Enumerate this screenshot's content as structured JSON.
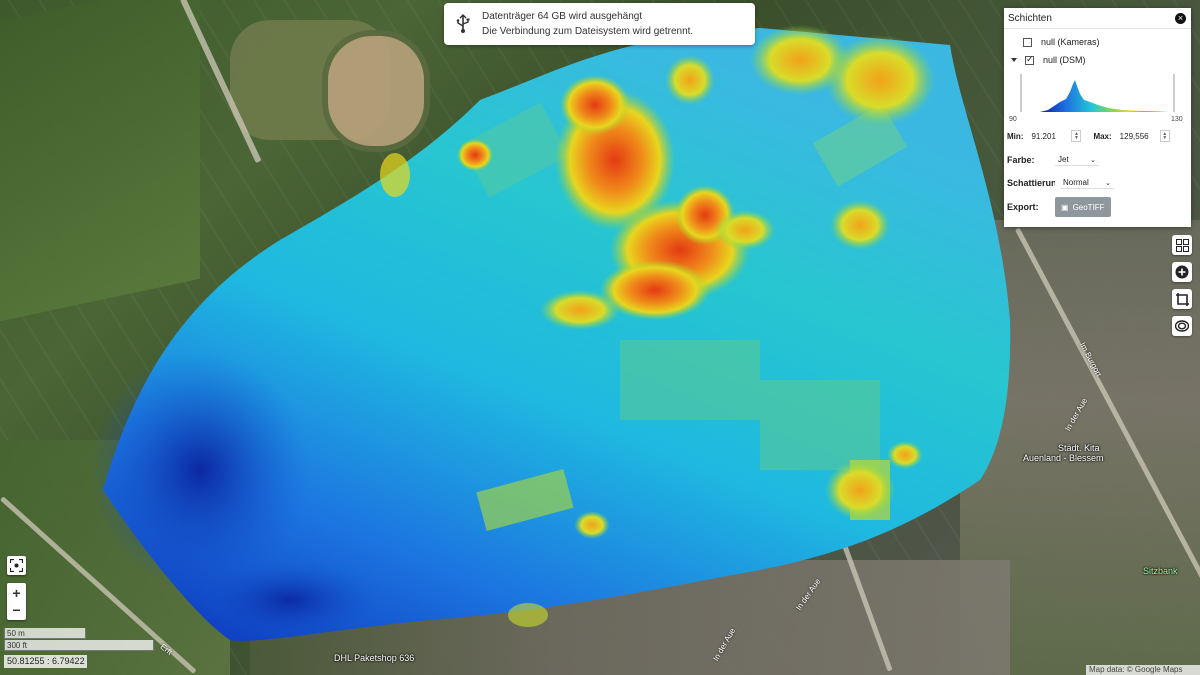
{
  "notification": {
    "title": "Datenträger 64 GB wird ausgehängt",
    "message": "Die Verbindung zum Dateisystem wird getrennt.",
    "icon": "usb-icon"
  },
  "layers_panel": {
    "title": "Schichten",
    "layers": [
      {
        "label": "null (Kameras)",
        "checked": false
      },
      {
        "label": "null (DSM)",
        "checked": true
      }
    ],
    "histogram": {
      "min_label": "90",
      "max_label": "130"
    },
    "min_label": "Min:",
    "min_value": "91.201",
    "max_label": "Max:",
    "max_value": "129,556",
    "color_label": "Farbe:",
    "color_value": "Jet",
    "shading_label": "Schattierung:",
    "shading_value": "Normal",
    "export_label": "Export:",
    "export_button": "GeoTIFF"
  },
  "map_labels": {
    "kita": "Städt. Kita",
    "kita2": "Auenland - Blessem",
    "in_der_aue_1": "In der Aue",
    "in_der_aue_2": "In der Aue",
    "in_der_aue_3": "In der Aue",
    "im_burgort": "Im Burgort",
    "sitzbank": "Sitzbank",
    "dhl": "DHL Paketshop 636",
    "erft": "Erft"
  },
  "scale": {
    "metric": "50 m",
    "imperial": "300 ft"
  },
  "coordinates": "50.81255 : 6.79422",
  "attribution": "Map data: © Google Maps",
  "colors": {
    "accent_button": "#8e979c"
  }
}
